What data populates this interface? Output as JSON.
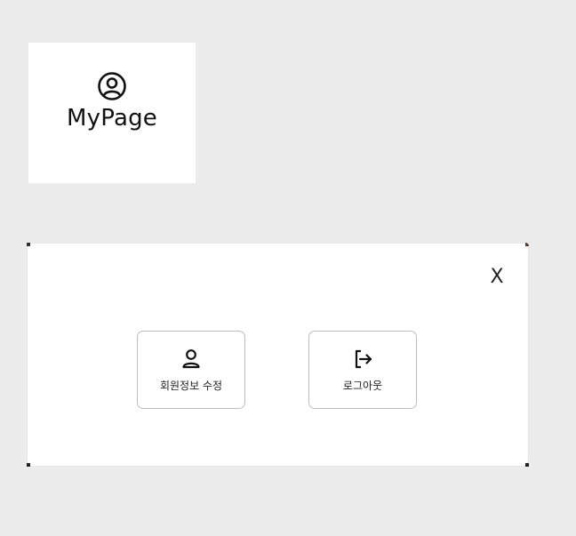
{
  "mypage": {
    "icon": "user-circle-icon",
    "title": "MyPage"
  },
  "modal": {
    "close_label": "X",
    "actions": [
      {
        "icon": "user-icon",
        "label": "회원정보 수정"
      },
      {
        "icon": "logout-icon",
        "label": "로그아웃"
      }
    ]
  }
}
